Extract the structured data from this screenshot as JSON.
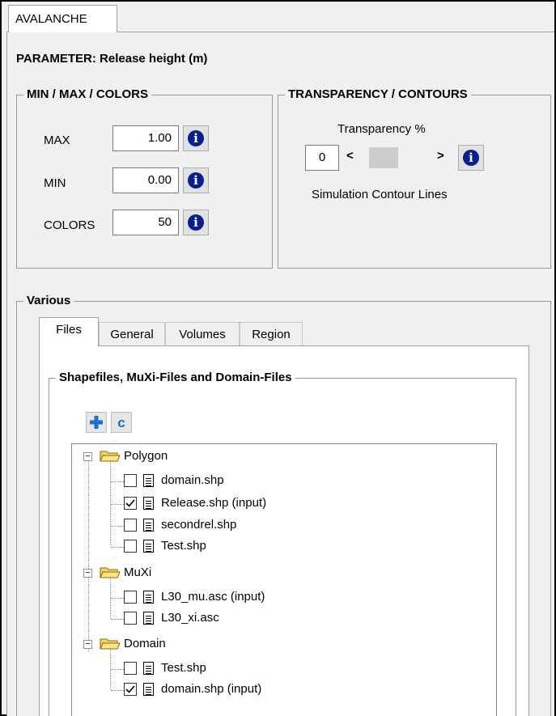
{
  "tab_title": "AVALANCHE",
  "parameter": "PARAMETER: Release height (m)",
  "minmax": {
    "title": "MIN / MAX / COLORS",
    "rows": [
      {
        "label": "MAX",
        "value": "1.00"
      },
      {
        "label": "MIN",
        "value": "0.00"
      },
      {
        "label": "COLORS",
        "value": "50"
      }
    ],
    "info_glyph": "i"
  },
  "transparency": {
    "title": "TRANSPARENCY / CONTOURS",
    "transparency_label": "Transparency %",
    "value": "0",
    "left_arrow": "<",
    "right_arrow": ">",
    "contour_label": "Simulation Contour Lines"
  },
  "various": {
    "title": "Various",
    "tabs": [
      "Files",
      "General",
      "Volumes",
      "Region"
    ],
    "active_tab": "Files"
  },
  "files": {
    "title": "Shapefiles, MuXi-Files and Domain-Files",
    "add_icon": "plus-icon",
    "refresh_icon": "refresh-icon",
    "refresh_glyph": "c"
  },
  "tree": {
    "groups": [
      {
        "name": "Polygon",
        "items": [
          {
            "label": "domain.shp",
            "checked": false
          },
          {
            "label": "Release.shp (input)",
            "checked": true
          },
          {
            "label": "secondrel.shp",
            "checked": false
          },
          {
            "label": "Test.shp",
            "checked": false
          }
        ]
      },
      {
        "name": "MuXi",
        "items": [
          {
            "label": "L30_mu.asc (input)",
            "checked": false
          },
          {
            "label": "L30_xi.asc",
            "checked": false
          }
        ]
      },
      {
        "name": "Domain",
        "items": [
          {
            "label": "Test.shp",
            "checked": false
          },
          {
            "label": "domain.shp (input)",
            "checked": true
          }
        ]
      }
    ]
  },
  "colors": {
    "info_blue": "#0a1f8f",
    "add_blue": "#1b6fd1",
    "folder_yellow": "#f5d55a"
  }
}
